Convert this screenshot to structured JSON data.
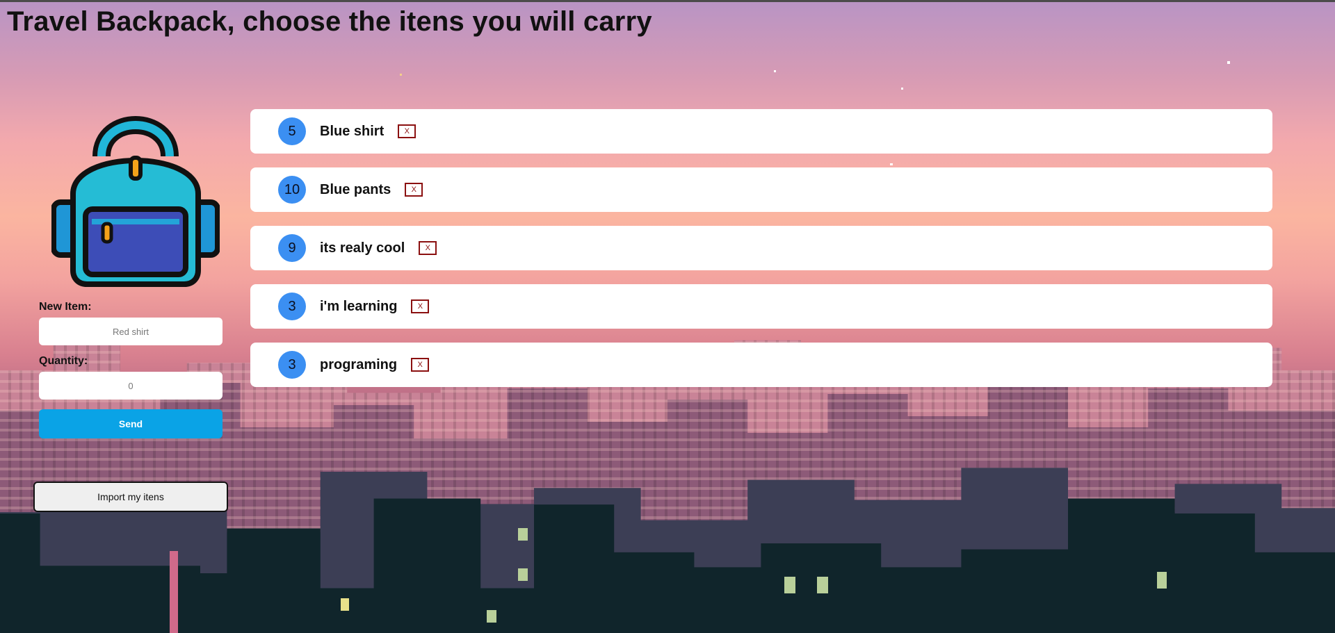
{
  "page": {
    "title": "Travel Backpack, choose the itens you will carry"
  },
  "form": {
    "item_label": "New Item:",
    "item_placeholder": "Red shirt",
    "quantity_label": "Quantity:",
    "quantity_placeholder": "0",
    "send_label": "Send"
  },
  "import_button": "Import my itens",
  "items": [
    {
      "quantity": "5",
      "name": "Blue shirt",
      "remove": "X"
    },
    {
      "quantity": "10",
      "name": "Blue pants",
      "remove": "X"
    },
    {
      "quantity": "9",
      "name": "its realy cool",
      "remove": "X"
    },
    {
      "quantity": "3",
      "name": "i'm learning",
      "remove": "X"
    },
    {
      "quantity": "3",
      "name": "programing",
      "remove": "X"
    }
  ],
  "colors": {
    "send_button": "#0aa3e6",
    "quantity_badge": "#3b8ff2",
    "remove_border": "#8b1010"
  },
  "icons": {
    "backpack": "backpack-icon"
  }
}
